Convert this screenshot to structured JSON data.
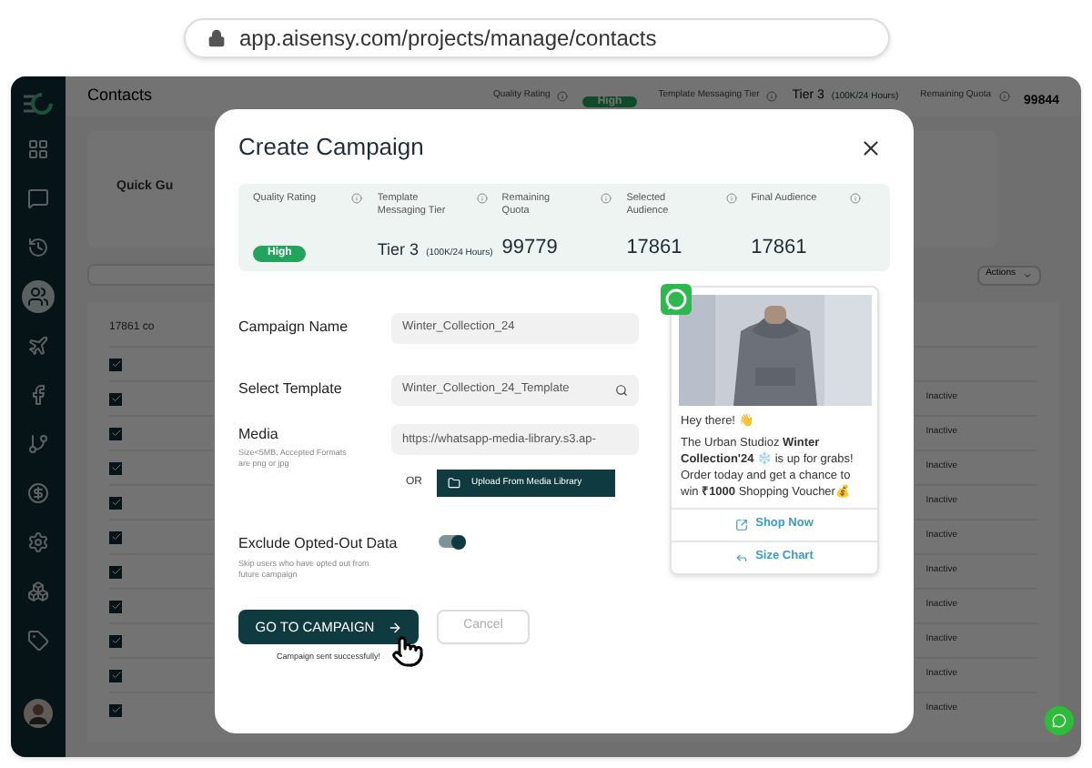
{
  "address_bar": {
    "url": "app.aisensy.com/projects/manage/contacts"
  },
  "sidebar": {
    "items": [
      {
        "selected": false
      },
      {
        "selected": false
      },
      {
        "selected": false
      },
      {
        "selected": true
      },
      {
        "selected": false
      },
      {
        "selected": false
      },
      {
        "selected": false
      },
      {
        "selected": false
      },
      {
        "selected": false
      },
      {
        "selected": false
      },
      {
        "selected": false
      }
    ]
  },
  "header": {
    "title": "Contacts",
    "stats": [
      {
        "label": "Quality Rating",
        "kind": "badge",
        "value": "High"
      },
      {
        "label": "Template Messaging Tier",
        "kind": "tier",
        "value": "Tier 3",
        "note": "(100K/24 Hours)"
      },
      {
        "label": "Remaining Quota",
        "kind": "number",
        "value": "99844"
      }
    ]
  },
  "background": {
    "quick_guide": "Quick Gu",
    "count": "17861 co",
    "actions": "Actions"
  },
  "table": {
    "rows": [
      {
        "checked": true
      },
      {
        "checked": true,
        "status": "Inactive"
      },
      {
        "checked": true,
        "status": "Inactive"
      },
      {
        "checked": true,
        "status": "Inactive"
      },
      {
        "checked": true,
        "status": "Inactive"
      },
      {
        "checked": true,
        "status": "Inactive"
      },
      {
        "checked": true,
        "status": "Inactive"
      },
      {
        "checked": true,
        "status": "Inactive"
      },
      {
        "checked": true,
        "status": "Inactive"
      },
      {
        "checked": true,
        "status": "Inactive"
      },
      {
        "checked": true,
        "status": "Inactive"
      }
    ]
  },
  "modal": {
    "title": "Create Campaign",
    "stats": [
      {
        "label": "Quality Rating",
        "kind": "badge",
        "value": "High"
      },
      {
        "label": "Template Messaging Tier",
        "kind": "tier",
        "value": "Tier 3",
        "note": "(100K/24 Hours)"
      },
      {
        "label": "Remaining Quota",
        "kind": "number",
        "value": "99779"
      },
      {
        "label": "Selected Audience",
        "kind": "number",
        "value": "17861"
      },
      {
        "label": "Final Audience",
        "kind": "number",
        "value": "17861"
      }
    ],
    "campaign_name": {
      "label": "Campaign Name",
      "value": "Winter_Collection_24"
    },
    "template": {
      "label": "Select Template",
      "value": "Winter_Collection_24_Template"
    },
    "media": {
      "label": "Media",
      "hint": "Size<5MB, Accepted Formats are png or jpg",
      "value": "https://whatsapp-media-library.s3.ap-",
      "or": "OR",
      "upload": "Upload From Media Library"
    },
    "exclude": {
      "label": "Exclude Opted-Out Data",
      "hint": "Skip users who have opted out from future campaign",
      "on": true
    },
    "preview": {
      "greeting": "Hey there! 👋",
      "message": "The Urban Studioz **Winter Collection'24** ❄️ is up for grabs! Order today and get a chance to win **₹1000** Shopping Voucher💰",
      "buttons": [
        {
          "kind": "link",
          "label": "Shop Now"
        },
        {
          "kind": "reply",
          "label": "Size Chart"
        }
      ]
    },
    "primary": "GO TO CAMPAIGN",
    "cancel": "Cancel",
    "success": "Campaign sent successfully!"
  }
}
